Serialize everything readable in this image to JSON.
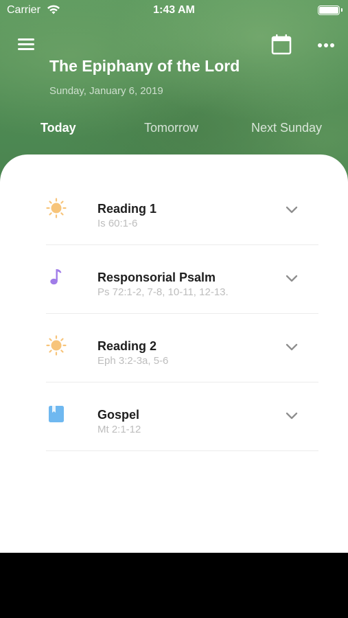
{
  "status_bar": {
    "carrier": "Carrier",
    "time": "1:43 AM"
  },
  "header": {
    "title": "The Epiphany of the Lord",
    "date": "Sunday, January 6, 2019",
    "icons": [
      "menu-icon",
      "calendar-icon",
      "more-icon"
    ]
  },
  "tabs": [
    {
      "label": "Today",
      "active": true
    },
    {
      "label": "Tomorrow",
      "active": false
    },
    {
      "label": "Next Sunday",
      "active": false
    }
  ],
  "readings": [
    {
      "title": "Reading 1",
      "reference": "Is 60:1-6",
      "icon": "sun-icon",
      "icon_color": "#f7c47a"
    },
    {
      "title": "Responsorial Psalm",
      "reference": "Ps 72:1-2, 7-8, 10-11, 12-13.",
      "icon": "music-note-icon",
      "icon_color": "#a07ce8"
    },
    {
      "title": "Reading 2",
      "reference": "Eph 3:2-3a, 5-6",
      "icon": "sun-icon",
      "icon_color": "#f7c47a"
    },
    {
      "title": "Gospel",
      "reference": "Mt 2:1-12",
      "icon": "book-icon",
      "icon_color": "#6fb8f0"
    }
  ],
  "colors": {
    "header_green": "#4e8a53",
    "reference_gray": "#bdbdbd",
    "chevron_gray": "#8e8e8e"
  }
}
